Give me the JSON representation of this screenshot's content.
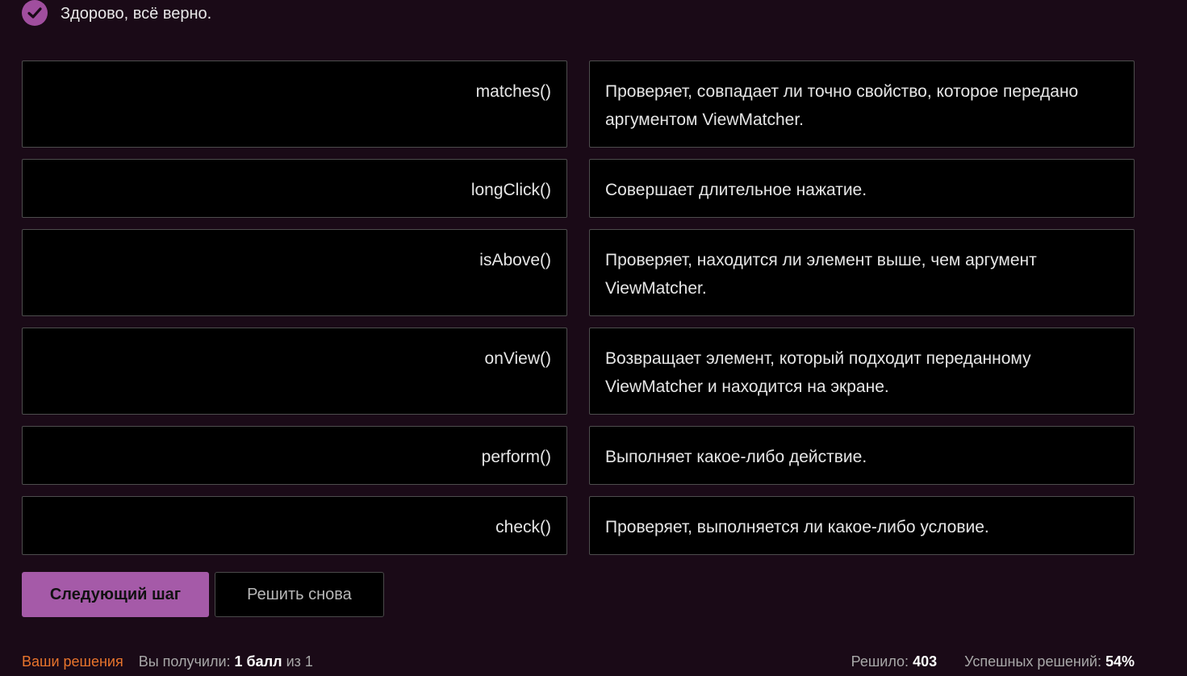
{
  "status": {
    "icon": "check-icon",
    "text": "Здорово, всё верно.",
    "icon_color": "#a04e9e"
  },
  "pairs": [
    {
      "term": "matches()",
      "definition": "Проверяет, совпадает ли точно свойство, которое передано аргументом ViewMatcher."
    },
    {
      "term": "longClick()",
      "definition": "Совершает длительное нажатие."
    },
    {
      "term": "isAbove()",
      "definition": "Проверяет, находится ли элемент выше, чем аргумент ViewMatcher."
    },
    {
      "term": "onView()",
      "definition": "Возвращает элемент, который подходит переданному ViewMatcher и находится на экране."
    },
    {
      "term": "perform()",
      "definition": "Выполняет какое-либо действие."
    },
    {
      "term": "check()",
      "definition": "Проверяет, выполняется ли какое-либо условие."
    }
  ],
  "buttons": {
    "next_step": "Следующий шаг",
    "solve_again": "Решить снова"
  },
  "footer": {
    "your_solutions_link": "Ваши решения",
    "score_prefix": "Вы получили: ",
    "score_value": "1 балл",
    "score_suffix": " из 1",
    "solved_label": "Решило: ",
    "solved_count": "403",
    "success_label": "Успешных решений: ",
    "success_rate": "54%"
  },
  "colors": {
    "background": "#1a0a17",
    "accent": "#a55aa8",
    "link": "#e8742c"
  }
}
